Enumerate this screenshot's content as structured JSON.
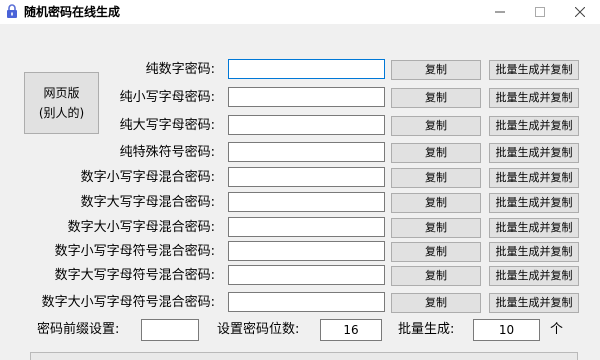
{
  "window": {
    "title": "随机密码在线生成"
  },
  "side_button": {
    "line1": "网页版",
    "line2": "(别人的)"
  },
  "rows": [
    {
      "label": "纯数字密码:",
      "value": "",
      "copy": "复制",
      "batch": "批量生成并复制"
    },
    {
      "label": "纯小写字母密码:",
      "value": "",
      "copy": "复制",
      "batch": "批量生成并复制"
    },
    {
      "label": "纯大写字母密码:",
      "value": "",
      "copy": "复制",
      "batch": "批量生成并复制"
    },
    {
      "label": "纯特殊符号密码:",
      "value": "",
      "copy": "复制",
      "batch": "批量生成并复制"
    },
    {
      "label": "数字小写字母混合密码:",
      "value": "",
      "copy": "复制",
      "batch": "批量生成并复制"
    },
    {
      "label": "数字大写字母混合密码:",
      "value": "",
      "copy": "复制",
      "batch": "批量生成并复制"
    },
    {
      "label": "数字大小写字母混合密码:",
      "value": "",
      "copy": "复制",
      "batch": "批量生成并复制"
    },
    {
      "label": "数字小写字母符号混合密码:",
      "value": "",
      "copy": "复制",
      "batch": "批量生成并复制"
    },
    {
      "label": "数字大写字母符号混合密码:",
      "value": "",
      "copy": "复制",
      "batch": "批量生成并复制"
    },
    {
      "label": "数字大小写字母符号混合密码:",
      "value": "",
      "copy": "复制",
      "batch": "批量生成并复制"
    }
  ],
  "settings": {
    "prefix_label": "密码前缀设置:",
    "prefix_value": "",
    "length_label": "设置密码位数:",
    "length_value": "16",
    "batch_label": "批量生成:",
    "batch_value": "10",
    "batch_unit": "个"
  }
}
